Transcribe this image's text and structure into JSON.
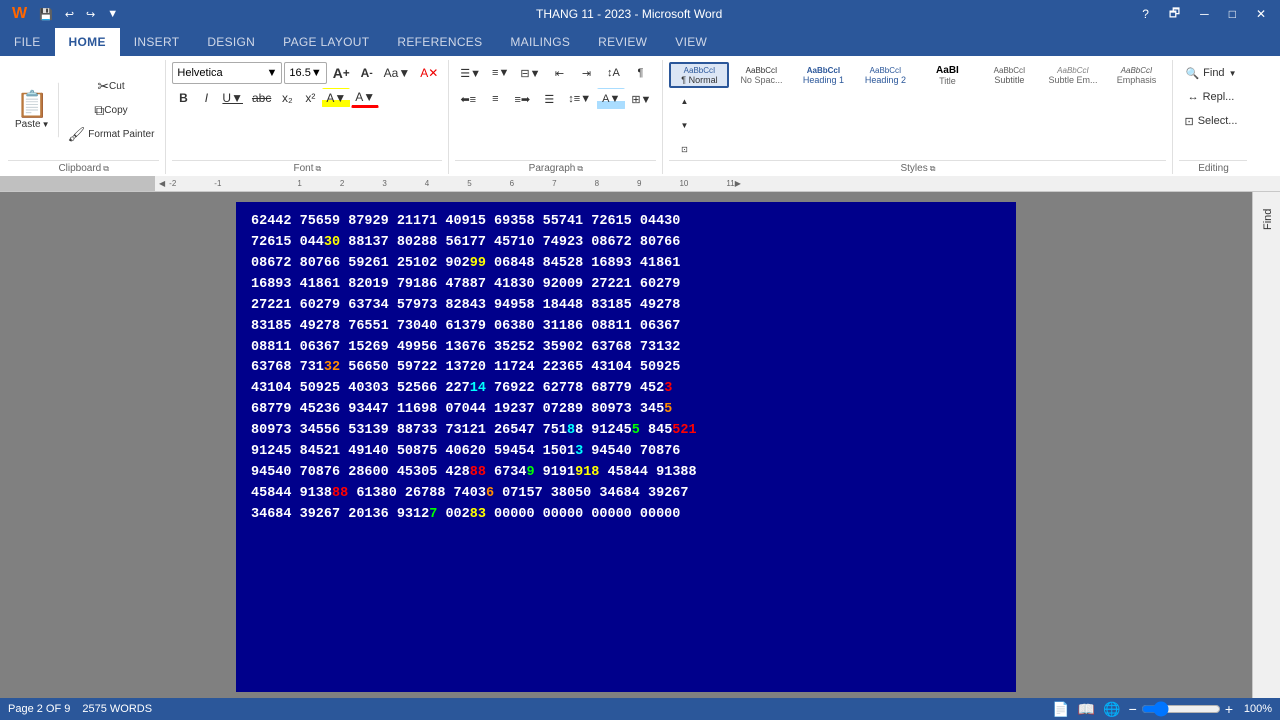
{
  "titlebar": {
    "title": "THANG 11 - 2023 - Microsoft Word",
    "quickaccess": [
      "save",
      "undo",
      "redo",
      "customize"
    ],
    "right_buttons": [
      "help",
      "restore",
      "close"
    ]
  },
  "ribbon": {
    "tabs": [
      "FILE",
      "HOME",
      "INSERT",
      "DESIGN",
      "PAGE LAYOUT",
      "REFERENCES",
      "MAILINGS",
      "REVIEW",
      "VIEW"
    ],
    "active_tab": "HOME",
    "clipboard": {
      "label": "Clipboard",
      "paste_label": "Paste",
      "cut_label": "Cut",
      "copy_label": "Copy",
      "format_painter_label": "Format Painter"
    },
    "font": {
      "label": "Font",
      "name": "Helvetica",
      "size": "16.5",
      "grow_label": "A",
      "shrink_label": "A",
      "case_label": "Aa",
      "clear_label": "A",
      "bold_label": "B",
      "italic_label": "I",
      "underline_label": "U",
      "strikethrough_label": "abc",
      "subscript_label": "x₂",
      "superscript_label": "x²",
      "highlight_label": "A",
      "color_label": "A"
    },
    "paragraph": {
      "label": "Paragraph",
      "bullets_label": "≡",
      "numbering_label": "≡",
      "multilevel_label": "≡",
      "decrease_label": "←",
      "increase_label": "→",
      "sort_label": "↕",
      "marks_label": "¶",
      "align_left_label": "≡",
      "align_center_label": "≡",
      "align_right_label": "≡",
      "justify_label": "≡",
      "line_spacing_label": "↕",
      "shading_label": "A",
      "borders_label": "⊞"
    },
    "styles": {
      "label": "Styles",
      "items": [
        {
          "name": "Normal",
          "label": "¶ Normal",
          "class": "style-normal"
        },
        {
          "name": "No Spacing",
          "label": "AaBbCcI",
          "subtitle": "No Spac...",
          "class": "style-nospace"
        },
        {
          "name": "Heading 1",
          "label": "AaBbCcI",
          "subtitle": "Heading 1",
          "class": "style-h1"
        },
        {
          "name": "Heading 2",
          "label": "AaBbCcI",
          "subtitle": "Heading 2",
          "class": "style-h2"
        },
        {
          "name": "Title",
          "label": "AaBI",
          "subtitle": "Title",
          "class": "style-title"
        },
        {
          "name": "Subtitle",
          "label": "AaBbCcI",
          "subtitle": "Subtitle",
          "class": "style-subtitle"
        },
        {
          "name": "Subtle Emphasis",
          "label": "AaBbCcI",
          "subtitle": "Subtle Em...",
          "class": "style-subtle"
        },
        {
          "name": "Emphasis",
          "label": "AaBbCcI",
          "subtitle": "Emphasis",
          "class": "style-emphasis"
        }
      ]
    },
    "editing": {
      "label": "Editing",
      "find_label": "Find",
      "replace_label": "Repl...",
      "select_label": "Select..."
    }
  },
  "document": {
    "content_lines": [
      {
        "text": "62442 75659 87929 21171 40915 69358 55741 72615 04430"
      },
      {
        "text": "72615 044",
        "colored": {
          "pos": 9,
          "text": "30",
          "color": "yellow"
        },
        "rest": " 88137 80288 56177 45710 74923 08672 80766"
      },
      {
        "text": "08672 80766 59261 25102 902",
        "colored": {
          "pos": 26,
          "text": "99",
          "color": "yellow"
        },
        "rest": " 06848 84528 16893 41861"
      },
      {
        "text": "16893 41861 82019 79186 47887 41830 92009 27221 60279"
      },
      {
        "text": "27221 60279 63734 57973 82843 94958 18448 83185 49278"
      },
      {
        "text": "83185 49278 76551 73040 61379 06380 31186 08811 06367"
      },
      {
        "text": "08811 06367 15269 49956 13676 35252 35902 63768 73132"
      },
      {
        "text": "63768 731",
        "colored": {
          "pos": 9,
          "text": "32",
          "color": "orange"
        },
        "rest": " 56650 59722 13720 11724 22365 43104 50925"
      },
      {
        "text": "43104 50925 40303 52566 227",
        "colored": {
          "pos": 26,
          "text": "14",
          "color": "cyan"
        },
        "rest": " 76922 62778 68779 452",
        "extra": {
          "text": "3",
          "color": "red"
        }
      },
      {
        "text": "68779 45236 93447 11698 07044 19237 07289 80973 345",
        "extra": {
          "text": "5",
          "color": "orange"
        }
      },
      {
        "text": "80973 34556 53139 88733 73121 26547 751",
        "colored": {
          "text": "8",
          "color": "cyan"
        },
        "more": "8 91245",
        "extra": {
          "text": "5",
          "color": "green"
        },
        "end": " 845",
        "finale": {
          "text": "521",
          "color": "red"
        }
      },
      {
        "text": "91245 84521 49140 50875 40620 59454 1501",
        "colored": {
          "text": "3",
          "color": "cyan"
        },
        "rest": " 94540 70876"
      },
      {
        "text": "94540 70876 28600 45305 428",
        "colored": {
          "text": "88",
          "color": "red"
        },
        "rest": " 6734",
        "extra": {
          "text": "9",
          "color": "green"
        },
        "end": " 9191",
        "finale": {
          "text": "918",
          "color": "yellow"
        },
        "tail": " 45844 91388"
      },
      {
        "text": "45844 9138",
        "colored": {
          "text": "88",
          "color": "red"
        },
        "rest": " 61380 26788 7403",
        "extra": {
          "text": "6",
          "color": "orange"
        },
        "end": " 07157 38050 34684 39267"
      },
      {
        "text": "34684 39267 20136 9312",
        "colored": {
          "text": "7",
          "color": "green"
        },
        "rest": " 002",
        "extra": {
          "text": "83",
          "color": "yellow"
        },
        "end": " 00000 00000 00000 00000"
      }
    ]
  },
  "statusbar": {
    "page_label": "Page 2 OF 9",
    "words_label": "2575 WORDS",
    "view_icons": [
      "print-layout",
      "full-reading",
      "web-layout"
    ],
    "zoom_level": "100%",
    "zoom_minus": "-",
    "zoom_plus": "+"
  }
}
